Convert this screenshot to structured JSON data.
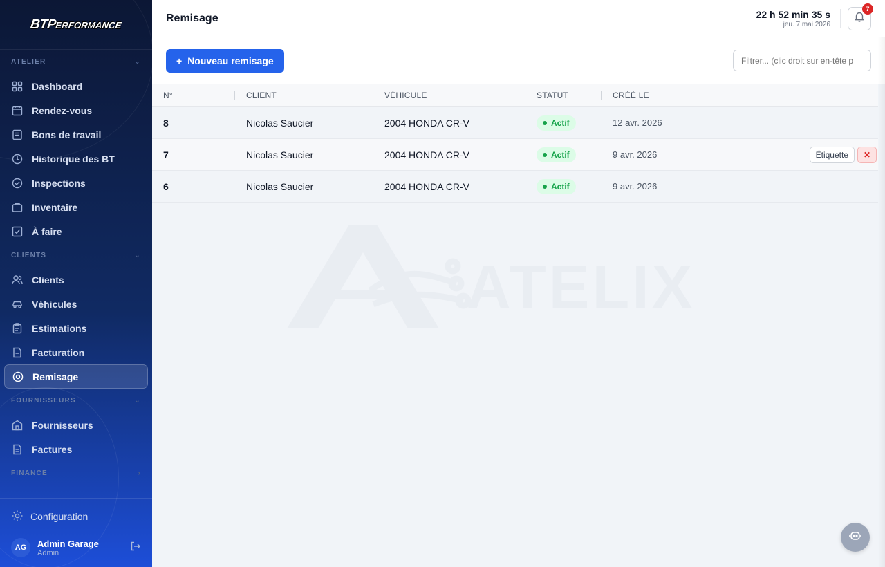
{
  "brand": {
    "logo_main": "BTP",
    "logo_rest": "ERFORMANCE"
  },
  "sidebar": {
    "sections": [
      {
        "title": "ATELIER",
        "items": [
          {
            "label": "Dashboard",
            "icon": "grid-icon"
          },
          {
            "label": "Rendez-vous",
            "icon": "calendar-icon"
          },
          {
            "label": "Bons de travail",
            "icon": "document-icon"
          },
          {
            "label": "Historique des BT",
            "icon": "clock-icon"
          },
          {
            "label": "Inspections",
            "icon": "check-circle-icon"
          },
          {
            "label": "Inventaire",
            "icon": "box-icon"
          },
          {
            "label": "À faire",
            "icon": "checkbox-icon"
          }
        ]
      },
      {
        "title": "CLIENTS",
        "items": [
          {
            "label": "Clients",
            "icon": "users-icon"
          },
          {
            "label": "Véhicules",
            "icon": "car-icon"
          },
          {
            "label": "Estimations",
            "icon": "clipboard-icon"
          },
          {
            "label": "Facturation",
            "icon": "invoice-icon"
          },
          {
            "label": "Remisage",
            "icon": "tire-icon"
          }
        ]
      },
      {
        "title": "FOURNISSEURS",
        "items": [
          {
            "label": "Fournisseurs",
            "icon": "building-icon"
          },
          {
            "label": "Factures",
            "icon": "file-icon"
          }
        ]
      },
      {
        "title": "FINANCE",
        "items": []
      }
    ],
    "active": "Remisage",
    "config_label": "Configuration",
    "user": {
      "initials": "AG",
      "name": "Admin Garage",
      "role": "Admin"
    }
  },
  "header": {
    "title": "Remisage",
    "clock_time": "22 h 52 min 35 s",
    "clock_date": "jeu. 7 mai 2026",
    "notifications_count": "7"
  },
  "toolbar": {
    "new_button": "Nouveau remisage",
    "filter_placeholder": "Filtrer... (clic droit sur en-tête p"
  },
  "table": {
    "columns": [
      "N°",
      "CLIENT",
      "VÉHICULE",
      "STATUT",
      "CRÉÉ LE"
    ],
    "rows": [
      {
        "num": "8",
        "client": "Nicolas Saucier",
        "vehicle": "2004 HONDA CR-V",
        "status": "Actif",
        "created": "12 avr. 2026"
      },
      {
        "num": "7",
        "client": "Nicolas Saucier",
        "vehicle": "2004 HONDA CR-V",
        "status": "Actif",
        "created": "9 avr. 2026"
      },
      {
        "num": "6",
        "client": "Nicolas Saucier",
        "vehicle": "2004 HONDA CR-V",
        "status": "Actif",
        "created": "9 avr. 2026"
      }
    ],
    "row_actions": {
      "label_button": "Étiquette",
      "delete_symbol": "✕"
    }
  },
  "watermark_text": "ATELIX",
  "colors": {
    "accent": "#2563eb",
    "status_active": "#16a34a",
    "danger": "#dc2626"
  }
}
